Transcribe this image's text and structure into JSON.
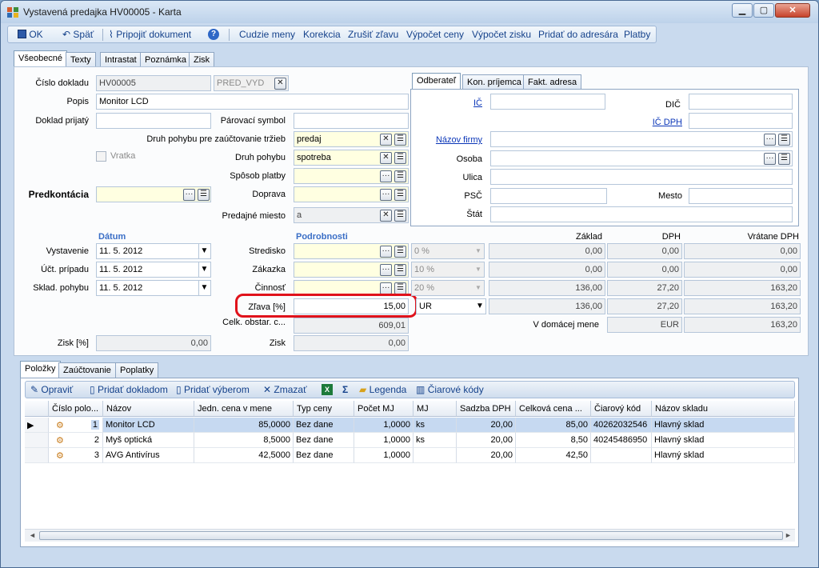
{
  "window": {
    "title": "Vystavená predajka HV00005 - Karta"
  },
  "toolbar": {
    "ok": "OK",
    "back": "Späť",
    "attach": "Pripojiť dokument",
    "items": [
      "Cudzie meny",
      "Korekcia",
      "Zrušiť zľavu",
      "Výpočet ceny",
      "Výpočet zisku",
      "Pridať do adresára",
      "Platby"
    ]
  },
  "tabs": [
    "Všeobecné",
    "Texty",
    "Intrastat",
    "Poznámka",
    "Zisk"
  ],
  "form": {
    "doc_no_label": "Číslo dokladu",
    "doc_no": "HV00005",
    "doc_series": "PRED_VYD",
    "desc_label": "Popis",
    "desc": "Monitor LCD",
    "received_label": "Doklad prijatý",
    "pair_label": "Párovací symbol",
    "movement_type_revenue_label": "Druh pohybu pre zaúčtovanie tržieb",
    "movement_type_revenue": "predaj",
    "movement_type_label": "Druh pohybu",
    "movement_type": "spotreba",
    "return_label": "Vratka",
    "payment_label": "Spôsob platby",
    "prekont_label": "Predkontácia",
    "transport_label": "Doprava",
    "sale_place_label": "Predajné miesto",
    "sale_place": "a",
    "date_header": "Dátum",
    "details_header": "Podrobnosti",
    "issue_label": "Vystavenie",
    "issue": "11. 5. 2012",
    "acc_label": "Účt. prípadu",
    "acc": "11. 5. 2012",
    "stock_label": "Sklad. pohybu",
    "stock": "11. 5. 2012",
    "center_label": "Stredisko",
    "order_label": "Zákazka",
    "activity_label": "Činnosť",
    "discount_label": "Zľava [%]",
    "discount": "15,00",
    "cost_label": "Celk. obstar. c...",
    "cost": "609,01",
    "profit_pct_label": "Zisk [%]",
    "profit_pct": "0,00",
    "profit_label": "Zisk",
    "profit": "0,00"
  },
  "partner": {
    "tabs": [
      "Odberateľ",
      "Kon. príjemca",
      "Fakt. adresa"
    ],
    "ico": "IČ",
    "dic": "DIČ",
    "icdph": "IČ DPH",
    "company": "Názov firmy",
    "person": "Osoba",
    "street": "Ulica",
    "zip": "PSČ",
    "city": "Mesto",
    "country": "Štát"
  },
  "vat": {
    "headers": [
      "Základ",
      "DPH",
      "Vrátane DPH"
    ],
    "rows": [
      {
        "rate": "0 %",
        "base": "0,00",
        "vat": "0,00",
        "total": "0,00"
      },
      {
        "rate": "10 %",
        "base": "0,00",
        "vat": "0,00",
        "total": "0,00"
      },
      {
        "rate": "20 %",
        "base": "136,00",
        "vat": "27,20",
        "total": "163,20"
      }
    ],
    "currency_sel": "UR",
    "sum_base": "136,00",
    "sum_vat": "27,20",
    "sum_total": "163,20",
    "domestic_label": "V domácej mene",
    "domestic_cur": "EUR",
    "domestic_total": "163,20"
  },
  "bottom_tabs": [
    "Položky",
    "Zaúčtovanie",
    "Poplatky"
  ],
  "grid_toolbar": [
    "Opraviť",
    "Pridať dokladom",
    "Pridať výberom",
    "Zmazať",
    "Legenda",
    "Čiarové kódy"
  ],
  "grid": {
    "headers": [
      "Číslo polo...",
      "Názov",
      "Jedn. cena v mene",
      "Typ ceny",
      "Počet MJ",
      "MJ",
      "Sadzba DPH",
      "Celková cena ...",
      "Čiarový kód",
      "Názov skladu"
    ],
    "rows": [
      [
        "1",
        "Monitor LCD",
        "85,0000",
        "Bez dane",
        "1,0000",
        "ks",
        "20,00",
        "85,00",
        "40262032546",
        "Hlavný sklad"
      ],
      [
        "2",
        "Myš optická",
        "8,5000",
        "Bez dane",
        "1,0000",
        "ks",
        "20,00",
        "8,50",
        "40245486950",
        "Hlavný sklad"
      ],
      [
        "3",
        "AVG Antivírus",
        "42,5000",
        "Bez dane",
        "1,0000",
        "",
        "20,00",
        "42,50",
        "",
        "Hlavný sklad"
      ]
    ]
  }
}
